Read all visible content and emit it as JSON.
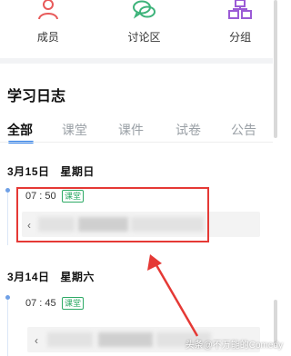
{
  "top_nav": {
    "items": [
      {
        "label": "成员",
        "icon": "members-icon"
      },
      {
        "label": "讨论区",
        "icon": "discussion-icon"
      },
      {
        "label": "分组",
        "icon": "groups-icon"
      }
    ],
    "colors": {
      "members": "#e85a5a",
      "discussion": "#3db37a",
      "groups": "#9b5bd6"
    }
  },
  "study_log": {
    "title": "学习日志",
    "tabs": [
      "全部",
      "课堂",
      "课件",
      "试卷",
      "公告"
    ],
    "active_tab": "全部",
    "entries": [
      {
        "date": "3月15日",
        "weekday": "星期日",
        "time": "07 : 50",
        "badge": "课堂"
      },
      {
        "date": "3月14日",
        "weekday": "星期六",
        "time": "07 : 45",
        "badge": "课堂"
      }
    ]
  },
  "watermark": "头条@不万能的Comedy",
  "colors": {
    "accent": "#1a73e8",
    "badge": "#2eaa66",
    "highlight": "#e53935"
  }
}
